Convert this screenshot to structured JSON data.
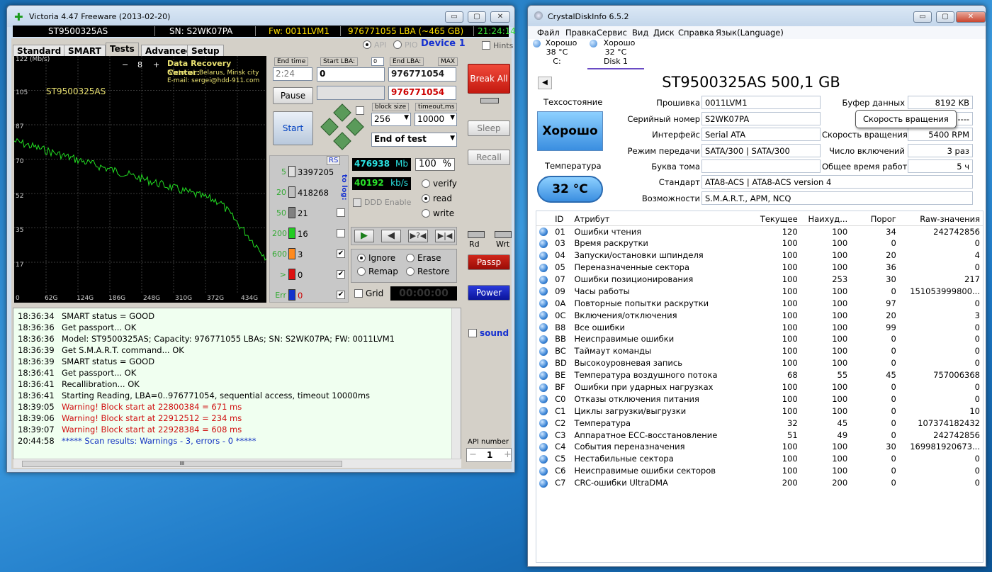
{
  "victoria": {
    "title": "Victoria 4.47  Freeware (2013-02-20)",
    "model": "ST9500325AS",
    "serial": "SN: S2WK07PA",
    "firmware": "Fw: 0011LVM1",
    "lba": "976771055 LBA (~465 GB)",
    "clock": "21:24:14",
    "tabs": [
      "Standard",
      "SMART",
      "Tests",
      "Advanced",
      "Setup"
    ],
    "api_label": "API",
    "pio_label": "PIO",
    "device": "Device 1",
    "hints": "Hints",
    "graph": {
      "yaxis_label": "122 (Mb/s)",
      "yticks": [
        "105",
        "87",
        "70",
        "52",
        "35",
        "17"
      ],
      "xticks": [
        "0",
        "62G",
        "124G",
        "186G",
        "248G",
        "310G",
        "372G",
        "434G"
      ],
      "disk_label": "ST9500325AS",
      "counter": "8",
      "minus": "−",
      "plus": "+",
      "center_title": "Data Recovery Center:",
      "center_line2": "'Victoria', Belarus, Minsk city",
      "center_line3": "E-mail: sergei@hdd-911.com"
    },
    "end_time_label": "End time",
    "end_time": "2:24",
    "start_lba_label": "Start LBA:",
    "start_lba_sel": "0",
    "start_lba": "0",
    "end_lba_label": "End LBA:",
    "end_lba_max": "MAX",
    "end_lba": "976771054",
    "end_lba2": "976771054",
    "pause": "Pause",
    "start": "Start",
    "block_size_label": "block size",
    "block_size": "256",
    "timeout_label": "timeout,ms",
    "timeout": "10000",
    "end_mode": "End of test",
    "break_all": "Break All",
    "sleep": "Sleep",
    "recall": "Recall",
    "passp": "Passp",
    "power": "Power",
    "rd": "Rd",
    "wrt": "Wrt",
    "rs": "RS",
    "to_log": "to log:",
    "counts": [
      {
        "label": "5",
        "value": "3397205",
        "color": "#e0e0e0"
      },
      {
        "label": "20",
        "value": "418268",
        "color": "#c0c0c0"
      },
      {
        "label": "50",
        "value": "21",
        "color": "#808080"
      },
      {
        "label": "200",
        "value": "16",
        "color": "#22cc22"
      },
      {
        "label": "600",
        "value": "3",
        "color": "#ff8a1e"
      },
      {
        "label": ">",
        "value": "0",
        "color": "#dd1111"
      },
      {
        "label": "Err",
        "value": "0",
        "color": "#1133cc"
      }
    ],
    "mb": "476938",
    "mb_unit": "Mb",
    "percent": "100",
    "percent_unit": "%",
    "kbs": "40192",
    "kbs_unit": "kb/s",
    "ddd": "DDD Enable",
    "verify": "verify",
    "read": "read",
    "write": "write",
    "ignore": "Ignore",
    "erase": "Erase",
    "remap": "Remap",
    "restore": "Restore",
    "grid": "Grid",
    "timer": "00:00:00",
    "sound": "sound",
    "api_number_label": "API number",
    "api_number": "1",
    "log": [
      {
        "time": "18:36:34",
        "text": "SMART status = GOOD",
        "warn": false
      },
      {
        "time": "18:36:36",
        "text": "Get passport... OK",
        "warn": false
      },
      {
        "time": "18:36:36",
        "text": "Model: ST9500325AS; Capacity: 976771055 LBAs; SN: S2WK07PA; FW: 0011LVM1",
        "warn": false
      },
      {
        "time": "18:36:39",
        "text": "Get S.M.A.R.T. command... OK",
        "warn": false
      },
      {
        "time": "18:36:39",
        "text": "SMART status = GOOD",
        "warn": false
      },
      {
        "time": "18:36:41",
        "text": "Get passport... OK",
        "warn": false
      },
      {
        "time": "18:36:41",
        "text": "Recallibration... OK",
        "warn": false
      },
      {
        "time": "18:36:41",
        "text": "Starting Reading, LBA=0..976771054, sequential access, timeout 10000ms",
        "warn": false
      },
      {
        "time": "18:39:05",
        "text": "Warning! Block start at 22800384 = 671 ms",
        "warn": true
      },
      {
        "time": "18:39:06",
        "text": "Warning! Block start at 22912512 = 234 ms",
        "warn": true
      },
      {
        "time": "18:39:07",
        "text": "Warning! Block start at 22928384 = 608 ms",
        "warn": true
      },
      {
        "time": "20:44:58",
        "text": "***** Scan results: Warnings - 3, errors - 0 *****",
        "warn": false,
        "blue": true
      }
    ],
    "scroll_mark": "III"
  },
  "cdi": {
    "title": "CrystalDiskInfo 6.5.2",
    "menu": [
      "Файл",
      "Правка",
      "Сервис",
      "Вид",
      "Диск",
      "Справка",
      "Язык(Language)"
    ],
    "disks": [
      {
        "status": "Хорошо",
        "temp": "38 °C",
        "name": "C:"
      },
      {
        "status": "Хорошо",
        "temp": "32 °C",
        "name": "Disk 1"
      }
    ],
    "drive_title": "ST9500325AS 500,1 GB",
    "health_label": "Техсостояние",
    "health": "Хорошо",
    "temp_label": "Температура",
    "temp": "32 °C",
    "info": [
      {
        "label": "Прошивка",
        "value": "0011LVM1"
      },
      {
        "label": "Серийный номер",
        "value": "S2WK07PA"
      },
      {
        "label": "Интерфейс",
        "value": "Serial ATA"
      },
      {
        "label": "Режим передачи",
        "value": "SATA/300 | SATA/300"
      },
      {
        "label": "Буква тома",
        "value": ""
      }
    ],
    "right": [
      {
        "label": "Буфер данных",
        "value": "8192 KB"
      },
      {
        "label": "",
        "value": "----"
      },
      {
        "label": "Скорость вращения",
        "value": "5400 RPM"
      },
      {
        "label": "Число включений",
        "value": "3 раз"
      },
      {
        "label": "Общее время работы",
        "value": "5 ч"
      }
    ],
    "standard_label": "Стандарт",
    "standard": "ATA8-ACS | ATA8-ACS version 4",
    "features_label": "Возможности",
    "features": "S.M.A.R.T., APM, NCQ",
    "tooltip": "Скорость вращения",
    "columns": [
      "ID",
      "Атрибут",
      "Текущее",
      "Наихуд...",
      "Порог",
      "Raw-значения"
    ],
    "rows": [
      [
        "01",
        "Ошибки чтения",
        "120",
        "100",
        "34",
        "242742856"
      ],
      [
        "03",
        "Время раскрутки",
        "100",
        "100",
        "0",
        "0"
      ],
      [
        "04",
        "Запуски/остановки шпинделя",
        "100",
        "100",
        "20",
        "4"
      ],
      [
        "05",
        "Переназначенные сектора",
        "100",
        "100",
        "36",
        "0"
      ],
      [
        "07",
        "Ошибки позиционирования",
        "100",
        "253",
        "30",
        "217"
      ],
      [
        "09",
        "Часы работы",
        "100",
        "100",
        "0",
        "151053999800..."
      ],
      [
        "0A",
        "Повторные попытки раскрутки",
        "100",
        "100",
        "97",
        "0"
      ],
      [
        "0C",
        "Включения/отключения",
        "100",
        "100",
        "20",
        "3"
      ],
      [
        "B8",
        "Все ошибки",
        "100",
        "100",
        "99",
        "0"
      ],
      [
        "BB",
        "Неисправимые ошибки",
        "100",
        "100",
        "0",
        "0"
      ],
      [
        "BC",
        "Таймаут команды",
        "100",
        "100",
        "0",
        "0"
      ],
      [
        "BD",
        "Высокоуровневая запись",
        "100",
        "100",
        "0",
        "0"
      ],
      [
        "BE",
        "Температура воздушного потока",
        "68",
        "55",
        "45",
        "757006368"
      ],
      [
        "BF",
        "Ошибки при ударных нагрузках",
        "100",
        "100",
        "0",
        "0"
      ],
      [
        "C0",
        "Отказы отключения питания",
        "100",
        "100",
        "0",
        "0"
      ],
      [
        "C1",
        "Циклы загрузки/выгрузки",
        "100",
        "100",
        "0",
        "10"
      ],
      [
        "C2",
        "Температура",
        "32",
        "45",
        "0",
        "107374182432"
      ],
      [
        "C3",
        "Аппаратное ECC-восстановление",
        "51",
        "49",
        "0",
        "242742856"
      ],
      [
        "C4",
        "События переназначения",
        "100",
        "100",
        "30",
        "169981920673..."
      ],
      [
        "C5",
        "Нестабильные сектора",
        "100",
        "100",
        "0",
        "0"
      ],
      [
        "C6",
        "Неисправимые ошибки секторов",
        "100",
        "100",
        "0",
        "0"
      ],
      [
        "C7",
        "CRC-ошибки UltraDMA",
        "200",
        "200",
        "0",
        "0"
      ]
    ]
  }
}
